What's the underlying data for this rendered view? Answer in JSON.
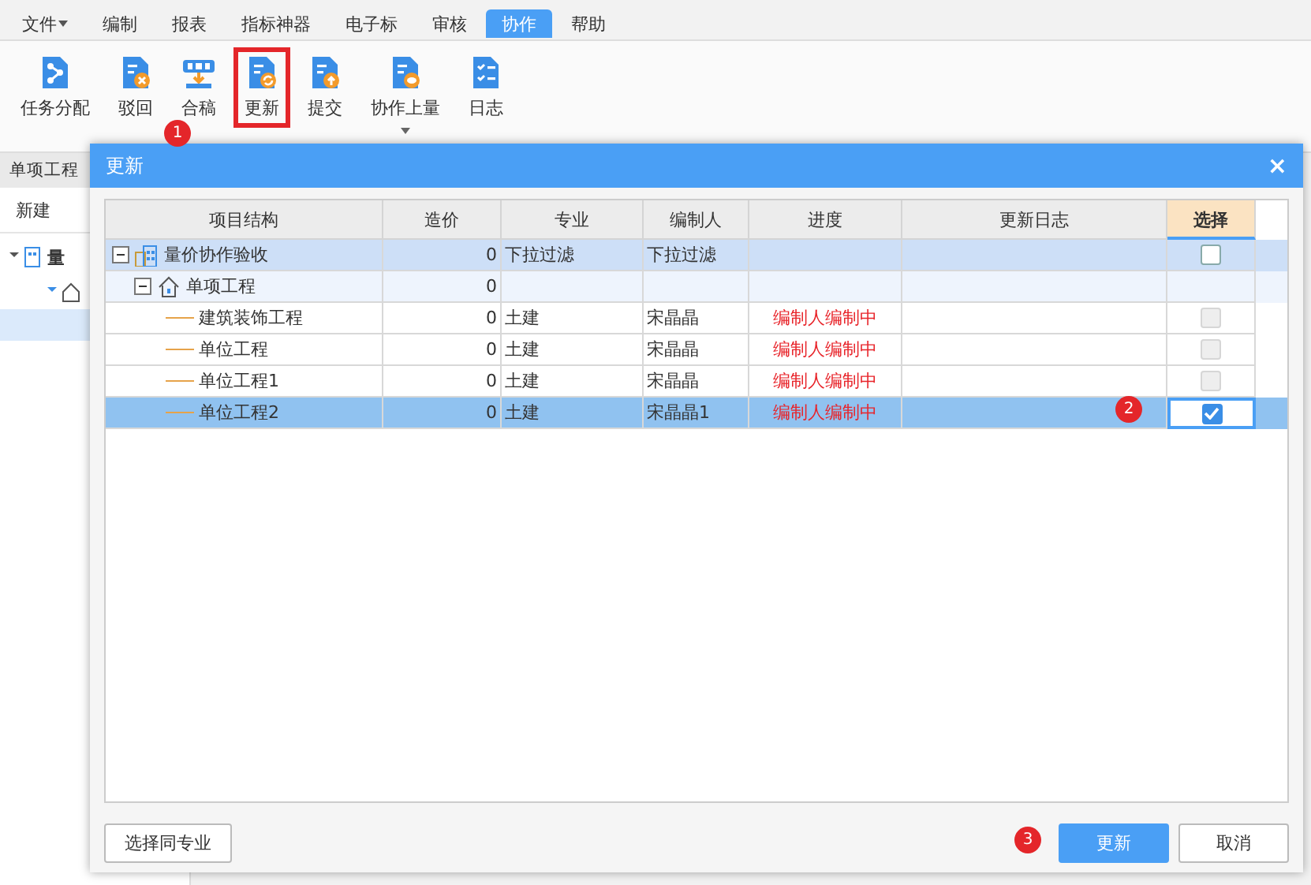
{
  "menu_tabs": [
    {
      "label": "文件",
      "dropdown": true,
      "selected": false
    },
    {
      "label": "编制",
      "dropdown": false,
      "selected": false
    },
    {
      "label": "报表",
      "dropdown": false,
      "selected": false
    },
    {
      "label": "指标神器",
      "dropdown": false,
      "selected": false
    },
    {
      "label": "电子标",
      "dropdown": false,
      "selected": false
    },
    {
      "label": "审核",
      "dropdown": false,
      "selected": false
    },
    {
      "label": "协作",
      "dropdown": false,
      "selected": true
    },
    {
      "label": "帮助",
      "dropdown": false,
      "selected": false
    }
  ],
  "toolbar": [
    {
      "label": "任务分配",
      "kind": "network",
      "highlighted": false,
      "dropdown": false
    },
    {
      "label": "驳回",
      "kind": "reject",
      "highlighted": false,
      "dropdown": false
    },
    {
      "label": "合稿",
      "kind": "merge",
      "highlighted": false,
      "dropdown": false
    },
    {
      "label": "更新",
      "kind": "refresh",
      "highlighted": true,
      "dropdown": false
    },
    {
      "label": "提交",
      "kind": "upload",
      "highlighted": false,
      "dropdown": false
    },
    {
      "label": "协作上量",
      "kind": "coin",
      "highlighted": false,
      "dropdown": true
    },
    {
      "label": "日志",
      "kind": "list",
      "highlighted": false,
      "dropdown": false
    }
  ],
  "left_panel": {
    "tab": "单项工程",
    "new_button": "新建",
    "tree_root": "量"
  },
  "dialog": {
    "title": "更新",
    "close": "×",
    "columns": [
      "项目结构",
      "造价",
      "专业",
      "编制人",
      "进度",
      "更新日志",
      "选择"
    ],
    "rows": [
      {
        "name": "量价协作验收",
        "kind": "project",
        "expanded": true,
        "cost": "0",
        "discipline": "下拉过滤",
        "editor": "下拉过滤",
        "checked": false,
        "disabled": false,
        "selected": false,
        "children": [
          {
            "name": "单项工程",
            "kind": "single",
            "expanded": true,
            "cost": "0",
            "selected": false,
            "children": [
              {
                "name": "建筑装饰工程",
                "kind": "unit",
                "cost": "0",
                "discipline": "土建",
                "editor": "宋晶晶",
                "progress": "编制人编制中",
                "checked": false,
                "disabled": true,
                "selected": false
              },
              {
                "name": "单位工程",
                "kind": "unit",
                "cost": "0",
                "discipline": "土建",
                "editor": "宋晶晶",
                "progress": "编制人编制中",
                "checked": false,
                "disabled": true,
                "selected": false
              },
              {
                "name": "单位工程1",
                "kind": "unit",
                "cost": "0",
                "discipline": "土建",
                "editor": "宋晶晶",
                "progress": "编制人编制中",
                "checked": false,
                "disabled": true,
                "selected": false
              },
              {
                "name": "单位工程2",
                "kind": "unit",
                "cost": "0",
                "discipline": "土建",
                "editor": "宋晶晶1",
                "progress": "编制人编制中",
                "checked": true,
                "disabled": false,
                "selected": true
              }
            ]
          }
        ]
      }
    ],
    "select_same_button": "选择同专业",
    "update_button": "更新",
    "cancel_button": "取消"
  },
  "callouts": [
    "1",
    "2",
    "3"
  ]
}
